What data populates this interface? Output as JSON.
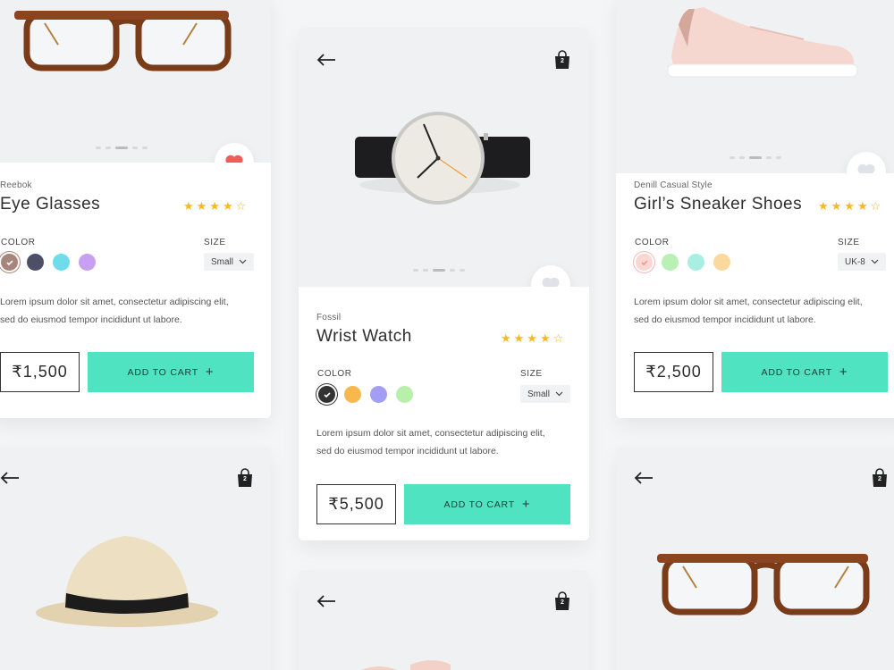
{
  "colors": {
    "accent": "#50e3c2",
    "star": "#f5b922",
    "heart": "#ef5c5c"
  },
  "cards": {
    "glasses": {
      "brand": "Reebok",
      "name": "Eye Glasses",
      "rating": 4,
      "rating_text": "★★★★☆",
      "color_label": "COLOR",
      "size_label": "SIZE",
      "size_value": "Small",
      "swatches": [
        "#a8857a",
        "#4d4f66",
        "#6fdcec",
        "#c8a0f2"
      ],
      "selected_swatch": 0,
      "favorite": true,
      "desc_line1": "Lorem ipsum dolor sit amet, consectetur adipiscing elit,",
      "desc_line2": "sed do eiusmod tempor incididunt ut labore.",
      "price": "₹1,500",
      "cart_label": "ADD TO CART"
    },
    "watch": {
      "brand": "Fossil",
      "name": "Wrist Watch",
      "rating": 4,
      "rating_text": "★★★★☆",
      "color_label": "COLOR",
      "size_label": "SIZE",
      "size_value": "Small",
      "swatches": [
        "#333333",
        "#f8b84e",
        "#a49df4",
        "#b7f0a8"
      ],
      "selected_swatch": 0,
      "favorite": false,
      "desc_line1": "Lorem ipsum dolor sit amet, consectetur adipiscing elit,",
      "desc_line2": "sed do eiusmod tempor incididunt ut labore.",
      "price": "₹5,500",
      "cart_label": "ADD TO CART",
      "bag_count": "2"
    },
    "sneaker": {
      "brand": "Denill Casual Style",
      "name": "Girl’s Sneaker Shoes",
      "rating": 4,
      "rating_text": "★★★★☆",
      "color_label": "COLOR",
      "size_label": "SIZE",
      "size_value": "UK-8",
      "swatches": [
        "#fbd7d3",
        "#b9f0b4",
        "#a8efe2",
        "#fbd99e"
      ],
      "selected_swatch": 0,
      "favorite": false,
      "desc_line1": "Lorem ipsum dolor sit amet, consectetur adipiscing elit,",
      "desc_line2": "sed do eiusmod tempor incididunt ut labore.",
      "price": "₹2,500",
      "cart_label": "ADD TO CART"
    },
    "hat": {
      "bag_count": "2"
    },
    "glasses2": {
      "bag_count": "2"
    },
    "bottom": {
      "bag_count": "2"
    }
  }
}
